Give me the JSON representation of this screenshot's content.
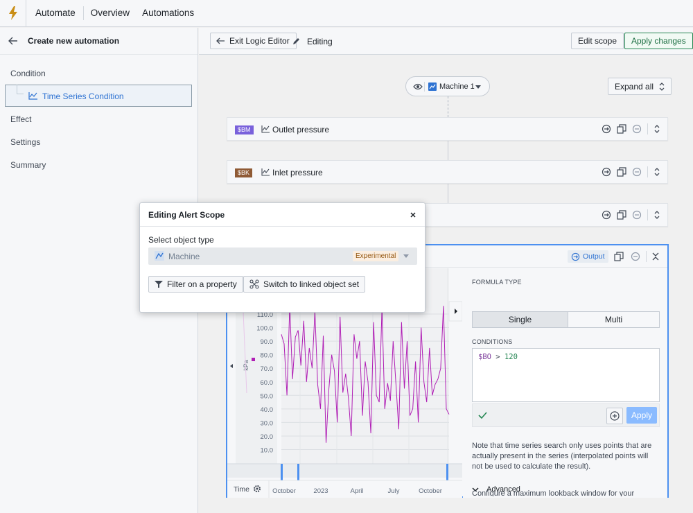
{
  "nav": {
    "automate": "Automate",
    "overview": "Overview",
    "automations": "Automations"
  },
  "left": {
    "title": "Create new automation",
    "condition": "Condition",
    "selected": "Time Series Condition",
    "effect": "Effect",
    "settings": "Settings",
    "summary": "Summary"
  },
  "header": {
    "exit": "Exit Logic Editor",
    "editing": "Editing",
    "edit_scope": "Edit scope",
    "apply_changes": "Apply changes"
  },
  "canvas": {
    "object": "Machine 1",
    "expand_all": "Expand all",
    "cards": [
      {
        "tag": "$BM",
        "tag_color": "#7961db",
        "name": "Outlet pressure"
      },
      {
        "tag": "$BK",
        "tag_color": "#8f5a35",
        "name": "Inlet pressure"
      },
      {
        "tag": "",
        "tag_color": "",
        "name": ""
      }
    ]
  },
  "bigcard": {
    "output": "Output"
  },
  "chart": {
    "ylabel": "kPa",
    "y_ticks": [
      "110.0",
      "100.0",
      "90.0",
      "80.0",
      "70.0",
      "60.0",
      "50.0",
      "40.0",
      "30.0",
      "20.0",
      "10.0"
    ],
    "x_label_time": "Time",
    "x_ticks": [
      "October",
      "2023",
      "April",
      "July",
      "October"
    ],
    "series_color": "#b01eb5"
  },
  "chart_data": {
    "type": "line",
    "ylabel": "kPa",
    "ylim": [
      5,
      117
    ],
    "x_ticks": [
      "October",
      "2023",
      "April",
      "July",
      "October"
    ],
    "series": [
      {
        "name": "",
        "values": [
          95,
          88,
          50,
          116,
          62,
          93,
          98,
          72,
          105,
          60,
          85,
          70,
          112,
          58,
          40,
          94,
          15,
          55,
          80,
          68,
          30,
          108,
          52,
          66,
          48,
          20,
          95,
          77,
          90,
          35,
          75,
          60,
          22,
          104,
          50,
          45,
          115,
          40,
          59,
          46,
          90,
          58,
          25,
          104,
          55,
          90,
          35,
          40,
          75,
          30,
          100,
          60,
          45,
          85,
          50,
          58,
          62,
          70,
          116,
          40,
          36
        ]
      }
    ]
  },
  "formula": {
    "type_label": "FORMULA TYPE",
    "single": "Single",
    "multi": "Multi",
    "conditions_label": "CONDITIONS",
    "var": "$BO",
    "op": ">",
    "value": "120",
    "apply": "Apply",
    "note": "Note that time series search only uses points that are actually present in the series (interpolated points will not be used to calculate the result).",
    "advanced": "Advanced",
    "lookback": "Configure a maximum lookback window for your"
  },
  "modal": {
    "title": "Editing Alert Scope",
    "select_label": "Select object type",
    "selected_value": "Machine",
    "badge": "Experimental",
    "filter_btn": "Filter on a property",
    "switch_btn": "Switch to linked object set"
  }
}
